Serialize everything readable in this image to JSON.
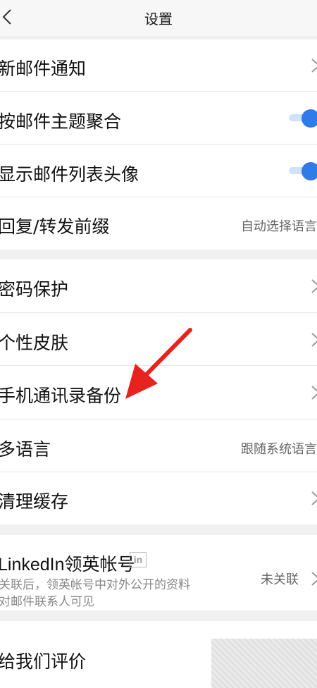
{
  "header": {
    "title": "设置"
  },
  "section1": [
    {
      "label": "新邮件通知",
      "type": "chevron"
    },
    {
      "label": "按邮件主题聚合",
      "type": "toggle",
      "on": true
    },
    {
      "label": "显示邮件列表头像",
      "type": "toggle",
      "on": true
    },
    {
      "label": "回复/转发前缀",
      "type": "value",
      "value": "自动选择语言"
    }
  ],
  "section2": [
    {
      "label": "密码保护",
      "type": "chevron"
    },
    {
      "label": "个性皮肤",
      "type": "chevron"
    },
    {
      "label": "手机通讯录备份",
      "type": "chevron"
    },
    {
      "label": "多语言",
      "type": "value",
      "value": "跟随系统语言"
    },
    {
      "label": "清理缓存",
      "type": "chevron"
    }
  ],
  "linkedin": {
    "title": "LinkedIn领英帐号",
    "badge": "in",
    "desc_line1": "关联后，领英帐号中对外公开的资料",
    "desc_line2": "对邮件联系人可见",
    "status": "未关联"
  },
  "rate": {
    "label": "给我们评价"
  },
  "colors": {
    "accent": "#2f7be8",
    "arrow": "#e8231f"
  }
}
